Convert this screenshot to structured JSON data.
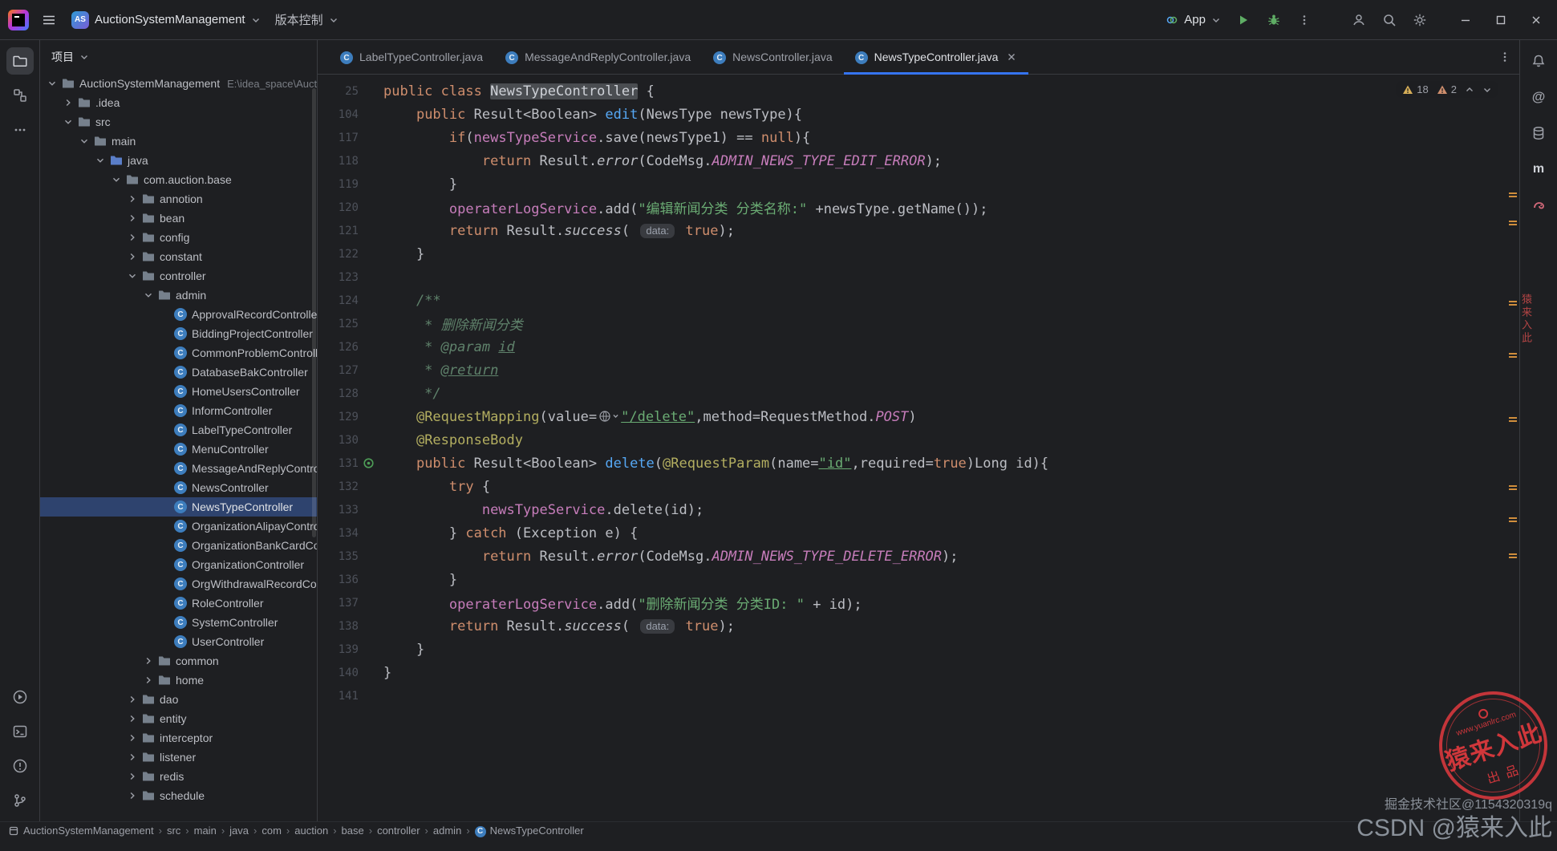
{
  "topbar": {
    "project_badge": "AS",
    "project_name": "AuctionSystemManagement",
    "vcs_label": "版本控制",
    "run_config_label": "App"
  },
  "icons": {
    "class_glyph": "C",
    "maven_glyph": "m",
    "ai_glyph": "@",
    "breadcrumb_separator": "›"
  },
  "project_panel": {
    "title": "项目",
    "tree": [
      {
        "label": "AuctionSystemManagement",
        "suffix": "E:\\idea_space\\Aucti",
        "level": 0,
        "chevron": "open",
        "icon": "folder"
      },
      {
        "label": ".idea",
        "level": 1,
        "chevron": "closed",
        "icon": "folder"
      },
      {
        "label": "src",
        "level": 1,
        "chevron": "open",
        "icon": "folder"
      },
      {
        "label": "main",
        "level": 2,
        "chevron": "open",
        "icon": "folder"
      },
      {
        "label": "java",
        "level": 3,
        "chevron": "open",
        "icon": "source-folder"
      },
      {
        "label": "com.auction.base",
        "level": 4,
        "chevron": "open",
        "icon": "package"
      },
      {
        "label": "annotion",
        "level": 5,
        "chevron": "closed",
        "icon": "package"
      },
      {
        "label": "bean",
        "level": 5,
        "chevron": "closed",
        "icon": "package"
      },
      {
        "label": "config",
        "level": 5,
        "chevron": "closed",
        "icon": "package"
      },
      {
        "label": "constant",
        "level": 5,
        "chevron": "closed",
        "icon": "package"
      },
      {
        "label": "controller",
        "level": 5,
        "chevron": "open",
        "icon": "package"
      },
      {
        "label": "admin",
        "level": 6,
        "chevron": "open",
        "icon": "package"
      },
      {
        "label": "ApprovalRecordController",
        "level": 7,
        "icon": "class"
      },
      {
        "label": "BiddingProjectController",
        "level": 7,
        "icon": "class"
      },
      {
        "label": "CommonProblemController",
        "level": 7,
        "icon": "class"
      },
      {
        "label": "DatabaseBakController",
        "level": 7,
        "icon": "class"
      },
      {
        "label": "HomeUsersController",
        "level": 7,
        "icon": "class"
      },
      {
        "label": "InformController",
        "level": 7,
        "icon": "class"
      },
      {
        "label": "LabelTypeController",
        "level": 7,
        "icon": "class"
      },
      {
        "label": "MenuController",
        "level": 7,
        "icon": "class"
      },
      {
        "label": "MessageAndReplyController",
        "level": 7,
        "icon": "class"
      },
      {
        "label": "NewsController",
        "level": 7,
        "icon": "class"
      },
      {
        "label": "NewsTypeController",
        "level": 7,
        "icon": "class",
        "selected": true
      },
      {
        "label": "OrganizationAlipayController",
        "level": 7,
        "icon": "class"
      },
      {
        "label": "OrganizationBankCardController",
        "level": 7,
        "icon": "class"
      },
      {
        "label": "OrganizationController",
        "level": 7,
        "icon": "class"
      },
      {
        "label": "OrgWithdrawalRecordController",
        "level": 7,
        "icon": "class"
      },
      {
        "label": "RoleController",
        "level": 7,
        "icon": "class"
      },
      {
        "label": "SystemController",
        "level": 7,
        "icon": "class"
      },
      {
        "label": "UserController",
        "level": 7,
        "icon": "class"
      },
      {
        "label": "common",
        "level": 6,
        "chevron": "closed",
        "icon": "package"
      },
      {
        "label": "home",
        "level": 6,
        "chevron": "closed",
        "icon": "package"
      },
      {
        "label": "dao",
        "level": 5,
        "chevron": "closed",
        "icon": "package"
      },
      {
        "label": "entity",
        "level": 5,
        "chevron": "closed",
        "icon": "package"
      },
      {
        "label": "interceptor",
        "level": 5,
        "chevron": "closed",
        "icon": "package"
      },
      {
        "label": "listener",
        "level": 5,
        "chevron": "closed",
        "icon": "package"
      },
      {
        "label": "redis",
        "level": 5,
        "chevron": "closed",
        "icon": "package"
      },
      {
        "label": "schedule",
        "level": 5,
        "chevron": "closed",
        "icon": "package"
      }
    ]
  },
  "tabs": [
    {
      "label": "LabelTypeController.java"
    },
    {
      "label": "MessageAndReplyController.java"
    },
    {
      "label": "NewsController.java"
    },
    {
      "label": "NewsTypeController.java",
      "active": true
    }
  ],
  "editor": {
    "inspection": {
      "warnings": "18",
      "weak_warnings": "2"
    },
    "stripe_marks": [
      147,
      182,
      282,
      347,
      427,
      512,
      552,
      597
    ],
    "lines": [
      {
        "num": "25",
        "tokens": [
          [
            "k",
            "public"
          ],
          [
            "d",
            " "
          ],
          [
            "k",
            "class"
          ],
          [
            "d",
            " "
          ],
          [
            "hl",
            "NewsTypeController"
          ],
          [
            "d",
            " {"
          ]
        ]
      },
      {
        "num": "104",
        "tokens": [
          [
            "d",
            "    "
          ],
          [
            "k",
            "public"
          ],
          [
            "d",
            " Result<Boolean> "
          ],
          [
            "m",
            "edit"
          ],
          [
            "d",
            "(NewsType newsType){"
          ]
        ]
      },
      {
        "num": "117",
        "tokens": [
          [
            "d",
            "        "
          ],
          [
            "k",
            "if"
          ],
          [
            "d",
            "("
          ],
          [
            "f",
            "newsTypeService"
          ],
          [
            "d",
            ".save(newsType1) == "
          ],
          [
            "k",
            "null"
          ],
          [
            "d",
            "){"
          ]
        ]
      },
      {
        "num": "118",
        "tokens": [
          [
            "d",
            "            "
          ],
          [
            "k",
            "return"
          ],
          [
            "d",
            " Result."
          ],
          [
            "sm",
            "error"
          ],
          [
            "d",
            "(CodeMsg."
          ],
          [
            "cn",
            "ADMIN_NEWS_TYPE_EDIT_ERROR"
          ],
          [
            "d",
            ");"
          ]
        ]
      },
      {
        "num": "119",
        "tokens": [
          [
            "d",
            "        }"
          ]
        ]
      },
      {
        "num": "120",
        "tokens": [
          [
            "d",
            "        "
          ],
          [
            "f",
            "operaterLogService"
          ],
          [
            "d",
            ".add("
          ],
          [
            "s",
            "\"编辑新闻分类 分类名称:\""
          ],
          [
            "d",
            " +newsType.getName());"
          ]
        ]
      },
      {
        "num": "121",
        "tokens": [
          [
            "d",
            "        "
          ],
          [
            "k",
            "return"
          ],
          [
            "d",
            " Result."
          ],
          [
            "sm",
            "success"
          ],
          [
            "d",
            "( "
          ],
          [
            "inlay",
            "data:"
          ],
          [
            "d",
            " "
          ],
          [
            "k",
            "true"
          ],
          [
            "d",
            ");"
          ]
        ]
      },
      {
        "num": "122",
        "tokens": [
          [
            "d",
            "    }"
          ]
        ]
      },
      {
        "num": "123",
        "tokens": []
      },
      {
        "num": "124",
        "tokens": [
          [
            "c",
            "    /**"
          ]
        ]
      },
      {
        "num": "125",
        "tokens": [
          [
            "c",
            "     * 删除新闻分类"
          ]
        ]
      },
      {
        "num": "126",
        "tokens": [
          [
            "c",
            "     * @param "
          ],
          [
            "cu",
            "id"
          ]
        ]
      },
      {
        "num": "127",
        "tokens": [
          [
            "c",
            "     * "
          ],
          [
            "cu",
            "@return"
          ]
        ]
      },
      {
        "num": "128",
        "tokens": [
          [
            "c",
            "     */"
          ]
        ]
      },
      {
        "num": "129",
        "tokens": [
          [
            "d",
            "    "
          ],
          [
            "a",
            "@RequestMapping"
          ],
          [
            "d",
            "(value="
          ],
          [
            "iglobe",
            ""
          ],
          [
            "su",
            "\"/delete\""
          ],
          [
            "d",
            ",method=RequestMethod."
          ],
          [
            "cn",
            "POST"
          ],
          [
            "d",
            ")"
          ]
        ]
      },
      {
        "num": "130",
        "tokens": [
          [
            "d",
            "    "
          ],
          [
            "a",
            "@ResponseBody"
          ]
        ]
      },
      {
        "num": "131",
        "gutter": "endpoint",
        "tokens": [
          [
            "d",
            "    "
          ],
          [
            "k",
            "public"
          ],
          [
            "d",
            " Result<Boolean> "
          ],
          [
            "m",
            "delete"
          ],
          [
            "d",
            "("
          ],
          [
            "a",
            "@RequestParam"
          ],
          [
            "d",
            "(name="
          ],
          [
            "su",
            "\"id\""
          ],
          [
            "d",
            ",required="
          ],
          [
            "k",
            "true"
          ],
          [
            "d",
            ")Long id){"
          ]
        ]
      },
      {
        "num": "132",
        "tokens": [
          [
            "d",
            "        "
          ],
          [
            "k",
            "try"
          ],
          [
            "d",
            " {"
          ]
        ]
      },
      {
        "num": "133",
        "tokens": [
          [
            "d",
            "            "
          ],
          [
            "f",
            "newsTypeService"
          ],
          [
            "d",
            ".delete(id);"
          ]
        ]
      },
      {
        "num": "134",
        "tokens": [
          [
            "d",
            "        } "
          ],
          [
            "k",
            "catch"
          ],
          [
            "d",
            " (Exception e) {"
          ]
        ]
      },
      {
        "num": "135",
        "tokens": [
          [
            "d",
            "            "
          ],
          [
            "k",
            "return"
          ],
          [
            "d",
            " Result."
          ],
          [
            "sm",
            "error"
          ],
          [
            "d",
            "(CodeMsg."
          ],
          [
            "cn",
            "ADMIN_NEWS_TYPE_DELETE_ERROR"
          ],
          [
            "d",
            ");"
          ]
        ]
      },
      {
        "num": "136",
        "tokens": [
          [
            "d",
            "        }"
          ]
        ]
      },
      {
        "num": "137",
        "tokens": [
          [
            "d",
            "        "
          ],
          [
            "f",
            "operaterLogService"
          ],
          [
            "d",
            ".add("
          ],
          [
            "s",
            "\"删除新闻分类 分类ID: \""
          ],
          [
            "d",
            " + id);"
          ]
        ]
      },
      {
        "num": "138",
        "tokens": [
          [
            "d",
            "        "
          ],
          [
            "k",
            "return"
          ],
          [
            "d",
            " Result."
          ],
          [
            "sm",
            "success"
          ],
          [
            "d",
            "( "
          ],
          [
            "inlay",
            "data:"
          ],
          [
            "d",
            " "
          ],
          [
            "k",
            "true"
          ],
          [
            "d",
            ");"
          ]
        ]
      },
      {
        "num": "139",
        "tokens": [
          [
            "d",
            "    }"
          ]
        ]
      },
      {
        "num": "140",
        "tokens": [
          [
            "d",
            "}"
          ]
        ]
      },
      {
        "num": "141",
        "tokens": []
      }
    ]
  },
  "breadcrumbs": [
    {
      "label": "AuctionSystemManagement",
      "icon": "project"
    },
    {
      "label": "src"
    },
    {
      "label": "main"
    },
    {
      "label": "java"
    },
    {
      "label": "com"
    },
    {
      "label": "auction"
    },
    {
      "label": "base"
    },
    {
      "label": "controller"
    },
    {
      "label": "admin"
    },
    {
      "label": "NewsTypeController",
      "icon": "class"
    }
  ],
  "watermarks": {
    "stamp_url": "www.yuanlrc.com",
    "stamp_main": "猿来入此",
    "stamp_sub": "出品",
    "side_text": "猿来入此",
    "line_small": "掘金技术社区@1154320319q",
    "line_big": "CSDN @猿来入此"
  }
}
